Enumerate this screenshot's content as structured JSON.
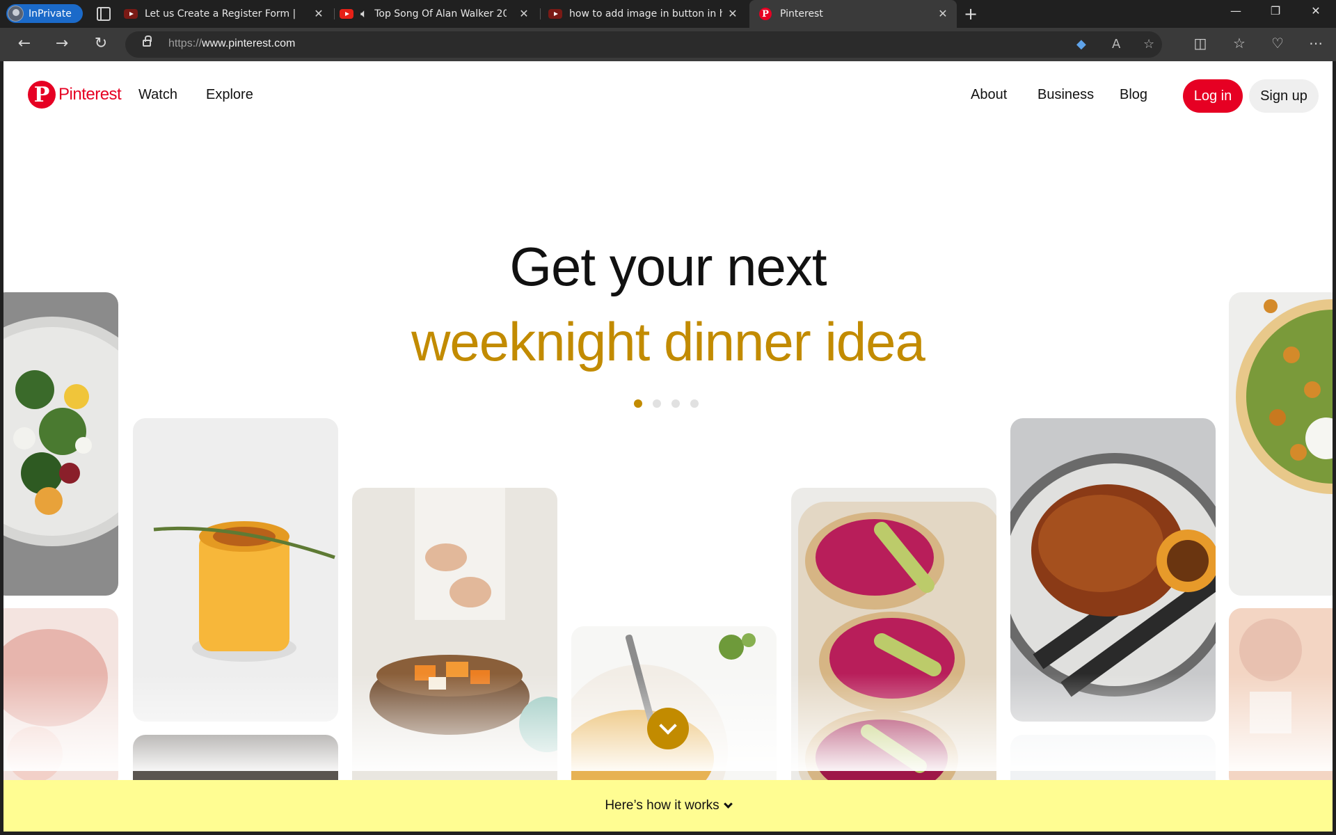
{
  "browser": {
    "profile_label": "InPrivate",
    "tabs": [
      {
        "title": "Let us Create a Register Form | St",
        "icon": "youtube-icon"
      },
      {
        "title": "Top Song Of Alan Walker 20",
        "icon": "youtube-icon",
        "audio": true
      },
      {
        "title": "how to add image in button in ht",
        "icon": "youtube-icon"
      },
      {
        "title": "Pinterest",
        "icon": "pinterest-icon",
        "active": true
      }
    ],
    "new_tab": "+",
    "window_controls": {
      "minimize": "—",
      "restore": "❐",
      "close": "✕"
    },
    "url_scheme": "https://",
    "url_host": "www.pinterest.com"
  },
  "site": {
    "brand": "Pinterest",
    "nav": {
      "watch": "Watch",
      "explore": "Explore",
      "about": "About",
      "business": "Business",
      "blog": "Blog"
    },
    "login": "Log in",
    "signup": "Sign up",
    "colors": {
      "brand_red": "#e60023",
      "accent_gold": "#c28b00",
      "how_bar": "#fffd92"
    }
  },
  "hero": {
    "line1": "Get your next",
    "line2": "weeknight dinner idea",
    "carousel_active": 1,
    "carousel_count": 4
  },
  "how_it_works": "Here’s how it works"
}
